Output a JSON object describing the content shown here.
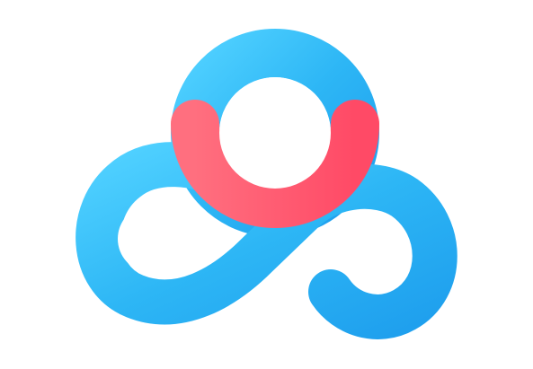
{
  "logo": {
    "name": "cloud-storage-logo",
    "colors": {
      "background": "#ffffff",
      "blue_light": "#4fd0ff",
      "blue_mid": "#2db6f5",
      "blue_dark": "#1fa0ee",
      "red_light": "#ff6f7f",
      "red_dark": "#ff4a66"
    }
  }
}
